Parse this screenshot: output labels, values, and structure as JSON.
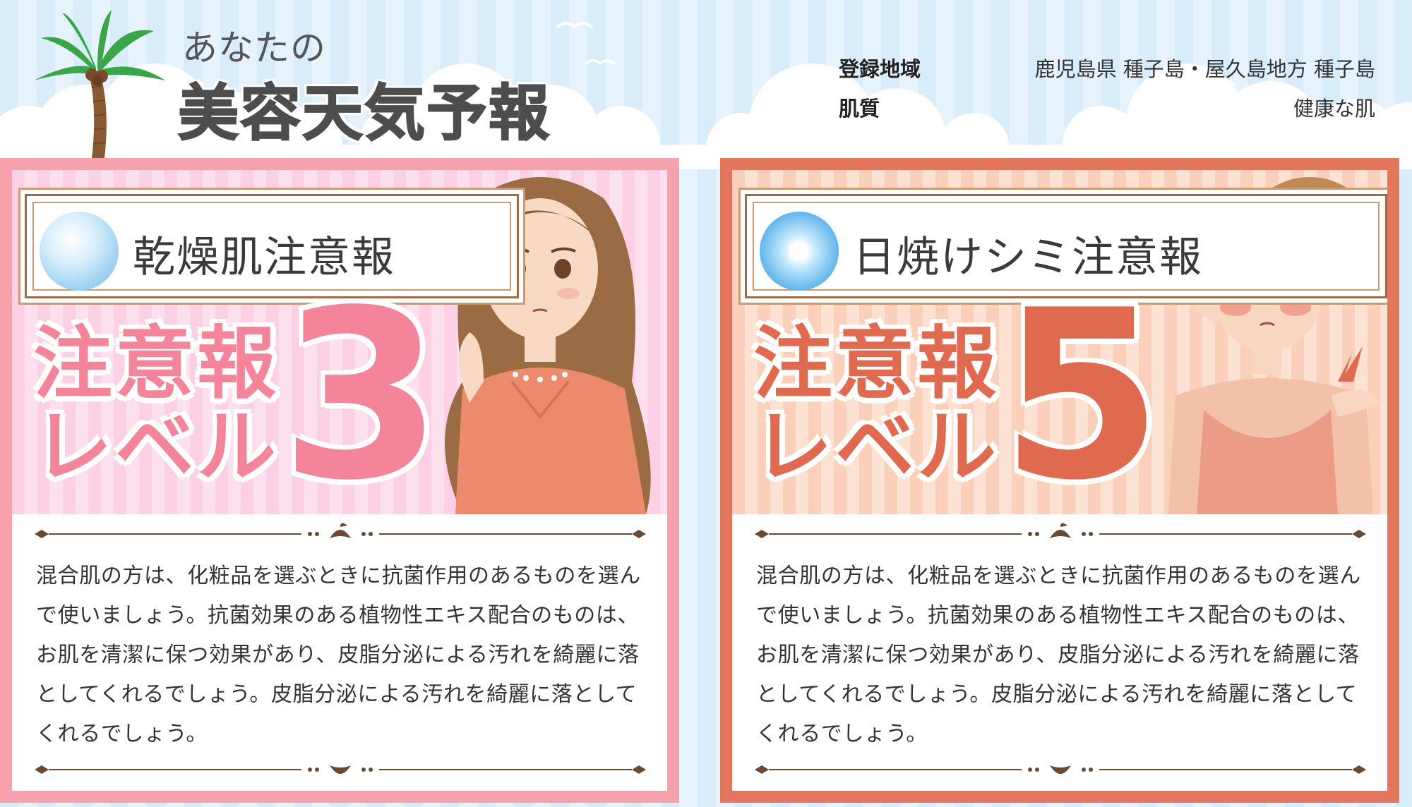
{
  "header": {
    "logo_small": "あなたの",
    "logo_big": "美容天気予報",
    "region_label": "登録地域",
    "region_value": "鹿児島県 種子島・屋久島地方 種子島",
    "skin_label": "肌質",
    "skin_value": "健康な肌"
  },
  "cards": [
    {
      "title": "乾燥肌注意報",
      "icon": "dry-skin-water-icon",
      "level_label_line1": "注意報",
      "level_label_line2": "レベル",
      "level_number": "3",
      "accent_color": "#f7a1ad",
      "text": "混合肌の方は、化粧品を選ぶときに抗菌作用のあるものを選んで使いましょう。抗菌効果のある植物性エキス配合のものは、お肌を清潔に保つ効果があり、皮脂分泌による汚れを綺麗に落としてくれるでしょう。皮脂分泌による汚れを綺麗に落としてくれるでしょう。"
    },
    {
      "title": "日焼けシミ注意報",
      "icon": "sun-burst-icon",
      "level_label_line1": "注意報",
      "level_label_line2": "レベル",
      "level_number": "5",
      "accent_color": "#e5765e",
      "text": "混合肌の方は、化粧品を選ぶときに抗菌作用のあるものを選んで使いましょう。抗菌効果のある植物性エキス配合のものは、お肌を清潔に保つ効果があり、皮脂分泌による汚れを綺麗に落としてくれるでしょう。皮脂分泌による汚れを綺麗に落としてくれるでしょう。"
    }
  ]
}
